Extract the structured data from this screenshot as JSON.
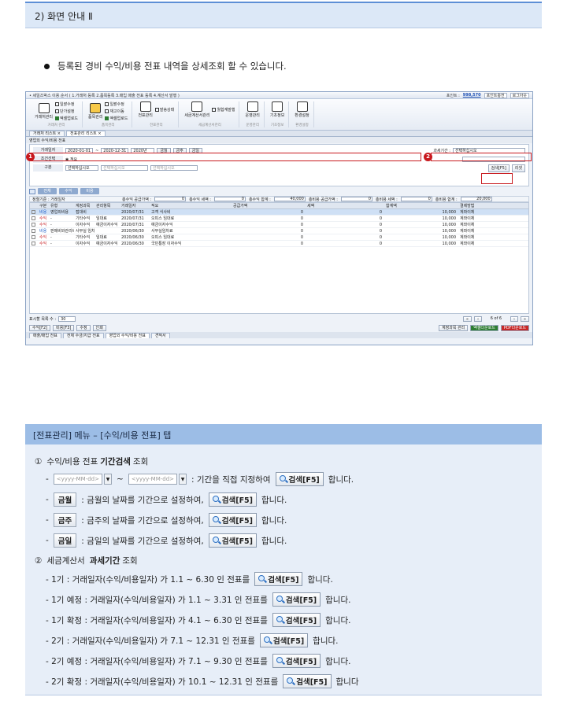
{
  "section": {
    "title": "2) 화면 안내 Ⅱ"
  },
  "bullet": {
    "text": "등록된 경비 수익/비용 전표 내역을 상세조회 할 수 있습니다."
  },
  "app": {
    "title": "• 세일즈박스 이용 순서 ( 1.거래처 등록 2.품목등록 3.매입 매출 전표 등록 4.계산서 발행 )",
    "point_label": "포인트 :",
    "point_value": "998,570",
    "point_charge": "포인트충전",
    "logout": "로그아웃",
    "ribbon": [
      {
        "big": "거래처관리",
        "small": [
          "일괄수정",
          "단가설정",
          "엑셀업로드"
        ],
        "group": "거래처 관리"
      },
      {
        "big": "품목관리",
        "small": [
          "일괄수정",
          "재고이동",
          "엑셀업로드"
        ],
        "group": "품목관리"
      },
      {
        "big": "전표관리",
        "small": [
          "발송상태"
        ],
        "group": "전표관리"
      },
      {
        "big": "세금계산서관리",
        "small": [
          "월합계발행"
        ],
        "group": "세금계산서관리"
      },
      {
        "big": "운영관리",
        "small": [],
        "group": "운영관리"
      },
      {
        "big": "기초정보",
        "small": [],
        "group": "기초정보"
      },
      {
        "big": "환경설정",
        "small": [],
        "group": "환경설정"
      }
    ],
    "tabs": [
      "거래처 리스트 ×",
      "전표관리 리스트 ×"
    ],
    "path": "영업외 수익/비용 전표",
    "search": {
      "date_label": "거래일자",
      "date_from": "2020-01-01",
      "date_to": "2020-12-31",
      "year": "2020년",
      "btn_month": "금월",
      "btn_week": "금주",
      "btn_day": "금일",
      "tax_label": "과세기간 :",
      "tax_value": "선택하십시오",
      "cond_label": "조건선택",
      "cond_value": "적요",
      "kind_label": "구분",
      "kind_value": "선택하십시오",
      "sel2": "선택하십시오",
      "sel3": "선택하십시오",
      "search_btn": "검색[F5]",
      "reset_btn": "리셋"
    },
    "filters": [
      "전체",
      "수익",
      "비용"
    ],
    "summary": {
      "criteria": "정렬기준 : 거래일자",
      "supply_label": "총수익 공급가액 :",
      "supply": "0",
      "tax_label": "총수익 세액 :",
      "tax": "0",
      "total_label": "총수익 합계 :",
      "total": "40,000",
      "exp_supply_label": "총비용 공급가액 :",
      "exp_supply": "0",
      "exp_tax_label": "총비용 세액 :",
      "exp_tax": "0",
      "exp_total_label": "총비용 합계 :",
      "exp_total": "20,000"
    },
    "columns": [
      "",
      "구분",
      "유형",
      "계정과목",
      "관리항목",
      "거래일자",
      "적요",
      "공급가액",
      "세액",
      "합계액",
      "결제방법"
    ],
    "rows": [
      {
        "kind": "비용",
        "type": "영업외비용",
        "account": "접대비",
        "mgmt": "",
        "date": "2020/07/31",
        "memo": "고객 식사비",
        "supply": "0",
        "tax": "0",
        "total": "10,000",
        "pay": "계좌이체",
        "color": "blue",
        "sel": true
      },
      {
        "kind": "수익",
        "type": "-",
        "account": "기타수익",
        "mgmt": "임대료",
        "date": "2020/07/31",
        "memo": "오피스 임대료",
        "supply": "0",
        "tax": "0",
        "total": "10,000",
        "pay": "계좌이체",
        "color": "red",
        "sel": false
      },
      {
        "kind": "수익",
        "type": "-",
        "account": "이자수익",
        "mgmt": "예금이자수익",
        "date": "2020/07/31",
        "memo": "예금이자수익",
        "supply": "0",
        "tax": "0",
        "total": "10,000",
        "pay": "계좌이체",
        "color": "red",
        "sel": false
      },
      {
        "kind": "비용",
        "type": "판매비와관리비",
        "account": "사무실 임차료",
        "mgmt": "",
        "date": "2020/06/30",
        "memo": "사무실임차료",
        "supply": "0",
        "tax": "0",
        "total": "10,000",
        "pay": "계좌이체",
        "color": "blue",
        "sel": false
      },
      {
        "kind": "수익",
        "type": "-",
        "account": "기타수익",
        "mgmt": "임대료",
        "date": "2020/06/30",
        "memo": "오피스 임대료",
        "supply": "0",
        "tax": "0",
        "total": "10,000",
        "pay": "계좌이체",
        "color": "red",
        "sel": false
      },
      {
        "kind": "수익",
        "type": "-",
        "account": "이자수익",
        "mgmt": "예금이자수익",
        "date": "2020/06/30",
        "memo": "국민통장 이자수익",
        "supply": "0",
        "tax": "0",
        "total": "10,000",
        "pay": "계좌이체",
        "color": "red",
        "sel": false
      }
    ],
    "pager": {
      "label": "표시할 목록 수 :",
      "value": "30",
      "pages": "6 of 6"
    },
    "bottom_left": [
      "수익[F2]",
      "비용[F3]",
      "수정",
      "인쇄"
    ],
    "bottom_right": [
      "계정과목 관리",
      "엑셀다운로드",
      "PDF다운로드"
    ],
    "status_tabs": [
      "매출/매입 전표",
      "전체 수금/지급 전표",
      "영업외 수익/비용 전표",
      "견적서"
    ],
    "markers": [
      "1",
      "2"
    ]
  },
  "info": {
    "header": "[전표관리] 메뉴 – [수익/비용 전표] 탭",
    "s1_num": "①",
    "s1_pre": "수익/비용 전표",
    "s1_bold": "기간검색",
    "s1_post": "조회",
    "date_placeholder": "<yyyy-MM-dd>",
    "tilde": "~",
    "l1_text": ": 기간을 직접 지정하여",
    "search_btn": "검색[F5]",
    "suffix": "합니다.",
    "l2_pill": "금월",
    "l2_text": ": 금월의 날짜를 기간으로 설정하여,",
    "l3_pill": "금주",
    "l3_text": ": 금주의 날짜를 기간으로 설정하여,",
    "l4_pill": "금일",
    "l4_text": ": 금일의 날짜를 기간으로 설정하여,",
    "s2_num": "②",
    "s2_pre": "세금계산서",
    "s2_bold": "과세기간",
    "s2_post": "조회",
    "periods": [
      {
        "text": "- 1기 : 거래일자(수익/비용일자) 가 1.1 ~ 6.30 인 전표를",
        "suffix": "합니다."
      },
      {
        "text": "- 1기 예정 : 거래일자(수익/비용일자) 가 1.1 ~ 3.31 인 전표를",
        "suffix": "합니다."
      },
      {
        "text": "- 1기 확정 : 거래일자(수익/비용일자) 가 4.1 ~ 6.30 인 전표를",
        "suffix": "합니다."
      },
      {
        "text": "- 2기 : 거래일자(수익/비용일자) 가 7.1 ~ 12.31 인 전표를",
        "suffix": "합니다."
      },
      {
        "text": "- 2기 예정 : 거래일자(수익/비용일자) 가 7.1 ~ 9.30 인 전표를",
        "suffix": "합니다."
      },
      {
        "text": "- 2기 확정 : 거래일자(수익/비용일자) 가 10.1 ~ 12.31 인 전표를",
        "suffix": "합니다"
      }
    ]
  }
}
